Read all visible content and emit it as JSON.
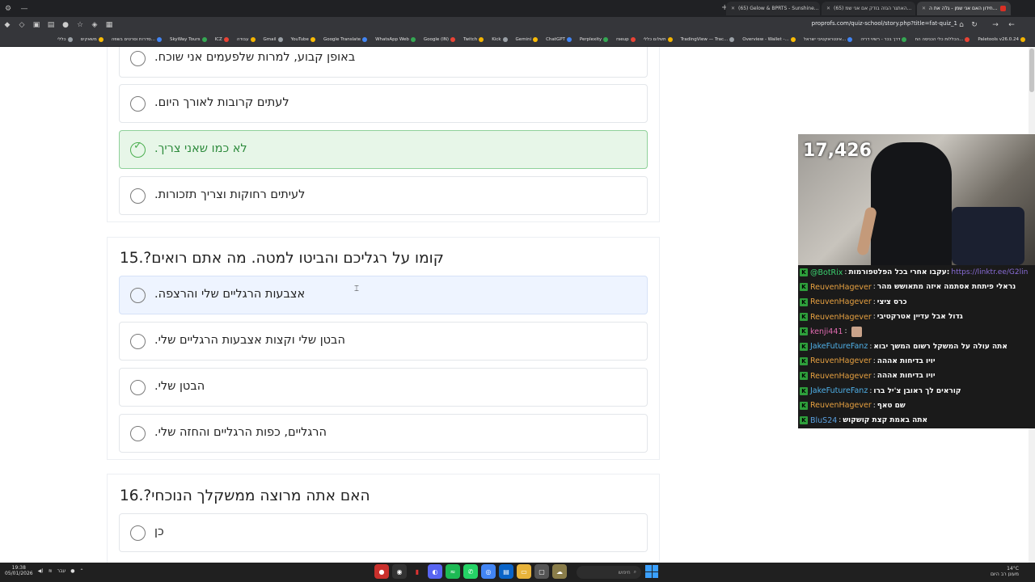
{
  "browser": {
    "tabs": [
      {
        "title": "חידון האם אני שמן - גלה את ה...",
        "active": true
      },
      {
        "title": "(65) האתגר הגזה בודק אם אני שמ...",
        "active": false
      },
      {
        "title": "(65) Gelow & BPRTS - Sunshine...",
        "active": false
      }
    ],
    "url": "proprofs.com/quiz-school/story.php?title=fat-quiz_1",
    "bookmarks": [
      "Paletools v26.0.24",
      "הכללות כלי הכניסה הח...",
      "דרך בכר - רשיוי דריה",
      "אינטראקטיבי ישראל...",
      "Overview - Wallet -...",
      "TradingView — Trac...",
      "תשלום כללי",
      "rseup",
      "Perplexity",
      "ChatGPT",
      "Gemini",
      "Kick",
      "Twitch",
      "Google (IN)",
      "WhatsApp Web",
      "Google Translate",
      "YouTube",
      "Gmail",
      "עבודה",
      "ICZ",
      "SkyWay Tours",
      "סדרות וסרטים בשפה...",
      "משאקים",
      "כללי"
    ]
  },
  "quiz": {
    "q14": {
      "options": [
        {
          "text": "באופן קבוע, למרות שלפעמים אני שוכח.",
          "state": "normal"
        },
        {
          "text": "לעתים קרובות לאורך היום.",
          "state": "normal"
        },
        {
          "text": "לא כמו שאני צריך.",
          "state": "correct"
        },
        {
          "text": "לעיתים רחוקות וצריך תזכורות.",
          "state": "normal"
        }
      ]
    },
    "q15": {
      "title": "15.?קומו על רגליכם והביטו למטה. מה אתם רואים",
      "options": [
        {
          "text": "אצבעות הרגליים שלי והרצפה.",
          "state": "hover"
        },
        {
          "text": "הבטן שלי וקצות אצבעות הרגליים שלי.",
          "state": "normal"
        },
        {
          "text": "הבטן שלי.",
          "state": "normal"
        },
        {
          "text": "הרגליים, כפות הרגליים והחזה שלי.",
          "state": "normal"
        }
      ]
    },
    "q16": {
      "title": "16.?האם אתה מרוצה ממשקלך הנוכחי",
      "options": [
        {
          "text": "כן",
          "state": "normal"
        }
      ]
    }
  },
  "stream": {
    "viewer_count": "17,426",
    "chat": [
      {
        "user": "@BotRix",
        "color": "#3bd16f",
        "msg": "עקבו אחרי בכל הפלטפורמות:",
        "link": "https://linktr.ee/G2lin"
      },
      {
        "user": "ReuvenHagever",
        "color": "#e6a040",
        "msg": "נראלי פיתחת אסתמה איזה מתאושש מהר"
      },
      {
        "user": "ReuvenHagever",
        "color": "#e6a040",
        "msg": "כרס ציצי"
      },
      {
        "user": "ReuvenHagever",
        "color": "#e6a040",
        "msg": "גדול אבל עדיין אטרקטיבי"
      },
      {
        "user": "kenji441",
        "color": "#e06bb0",
        "msg": ""
      },
      {
        "user": "JakeFutureFanz",
        "color": "#4fb0e8",
        "msg": "אתה עולה על המשקל רשום המשך יבוא"
      },
      {
        "user": "ReuvenHagever",
        "color": "#e6a040",
        "msg": "יויו בדיחות אההה"
      },
      {
        "user": "ReuvenHagever",
        "color": "#e6a040",
        "msg": "יויו בדיחות אההה"
      },
      {
        "user": "JakeFutureFanz",
        "color": "#4fb0e8",
        "msg": "קוראים לך ראובן צ'יל ברו"
      },
      {
        "user": "ReuvenHagever",
        "color": "#e6a040",
        "msg": "שם טאף"
      },
      {
        "user": "BluS24",
        "color": "#5aa0e0",
        "msg": "אתה באמת קצת קושקוש"
      }
    ]
  },
  "taskbar": {
    "time": "19:38",
    "date": "05/01/2026",
    "lang": "עבר",
    "search_placeholder": "חיפוש",
    "weather_temp": "14°C",
    "weather_desc": "מעונן רב היום"
  }
}
